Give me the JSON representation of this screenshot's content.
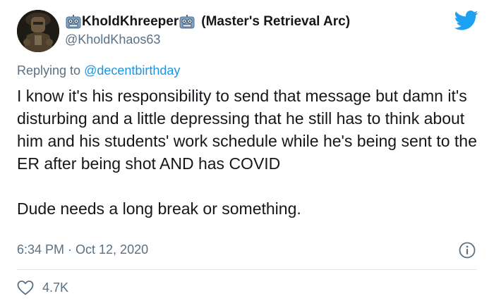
{
  "tweet": {
    "author": {
      "display_name": "KholdKhreeper",
      "name_suffix": "(Master's Retrieval Arc)",
      "handle": "@KholdKhaos63",
      "name_emoji": "robot-face-icon"
    },
    "reply_prefix": "Replying to",
    "reply_mention": "@decentbirthday",
    "text_paragraphs": [
      "I know it's his responsibility to send that message but damn it's disturbing and a little depressing that he still has to think about him and his students' work schedule while he's being sent to the ER after being shot AND has COVID",
      "Dude needs a long break or something."
    ],
    "timestamp": "6:34 PM · Oct 12, 2020",
    "like_count": "4.7K"
  },
  "icons": {
    "brand": "twitter-bird-icon",
    "info": "info-icon",
    "like": "heart-icon"
  },
  "colors": {
    "brand_blue": "#1da1f2",
    "link_blue": "#1b95e0",
    "muted_text": "#5b7083",
    "body_text": "#14171a"
  }
}
